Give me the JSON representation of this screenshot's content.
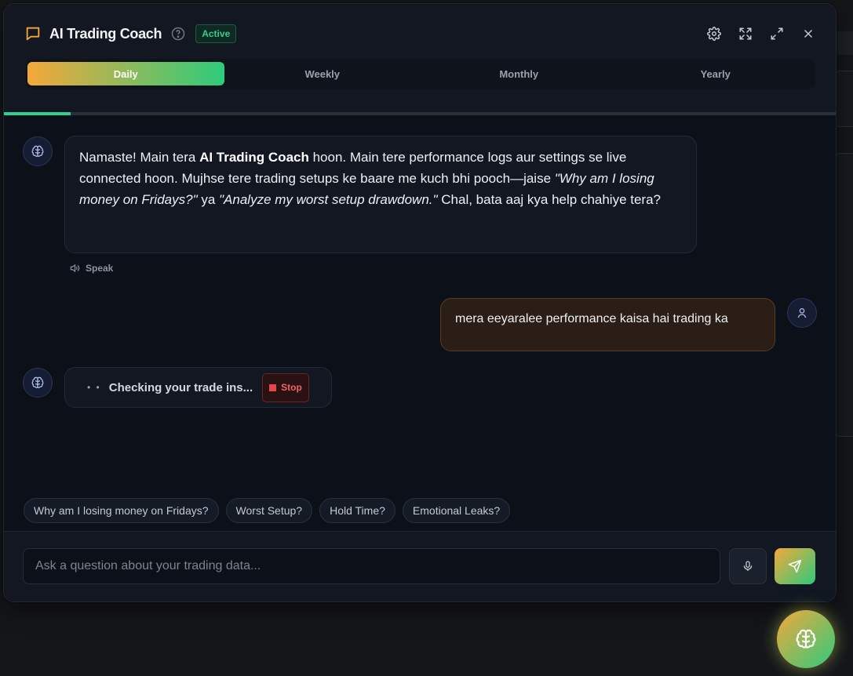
{
  "header": {
    "title": "AI Trading Coach",
    "status": "Active",
    "icons": [
      "chat-icon",
      "help-icon",
      "settings-icon",
      "expand-icon",
      "maximize-icon",
      "close-icon"
    ]
  },
  "tabs": [
    {
      "label": "Daily",
      "active": true
    },
    {
      "label": "Weekly",
      "active": false
    },
    {
      "label": "Monthly",
      "active": false
    },
    {
      "label": "Yearly",
      "active": false
    }
  ],
  "progress": 0.08,
  "messages": {
    "ai_intro": {
      "p1": "Namaste! Main tera ",
      "bold": "AI Trading Coach",
      "p2": " hoon. Main tere performance logs aur settings se live connected hoon. Mujhse tere trading setups ke baare me kuch bhi pooch—jaise ",
      "q1": "\"Why am I losing money on Fridays?\"",
      "p3": " ya ",
      "q2": "\"Analyze my worst setup drawdown.\"",
      "p4": " Chal, bata aaj kya help chahiye tera?",
      "speak": "Speak"
    },
    "user": "mera eeyaralee performance kaisa hai trading ka",
    "ai_loading": {
      "text": "Checking your trade ins...",
      "stop": "Stop"
    }
  },
  "suggestions": [
    "Why am I losing money on Fridays?",
    "Worst Setup?",
    "Hold Time?",
    "Emotional Leaks?"
  ],
  "input": {
    "placeholder": "Ask a question about your trading data...",
    "value": ""
  },
  "colors": {
    "accent_orange": "#f4a83a",
    "accent_green": "#2dcb7c",
    "background": "#0c1019"
  }
}
